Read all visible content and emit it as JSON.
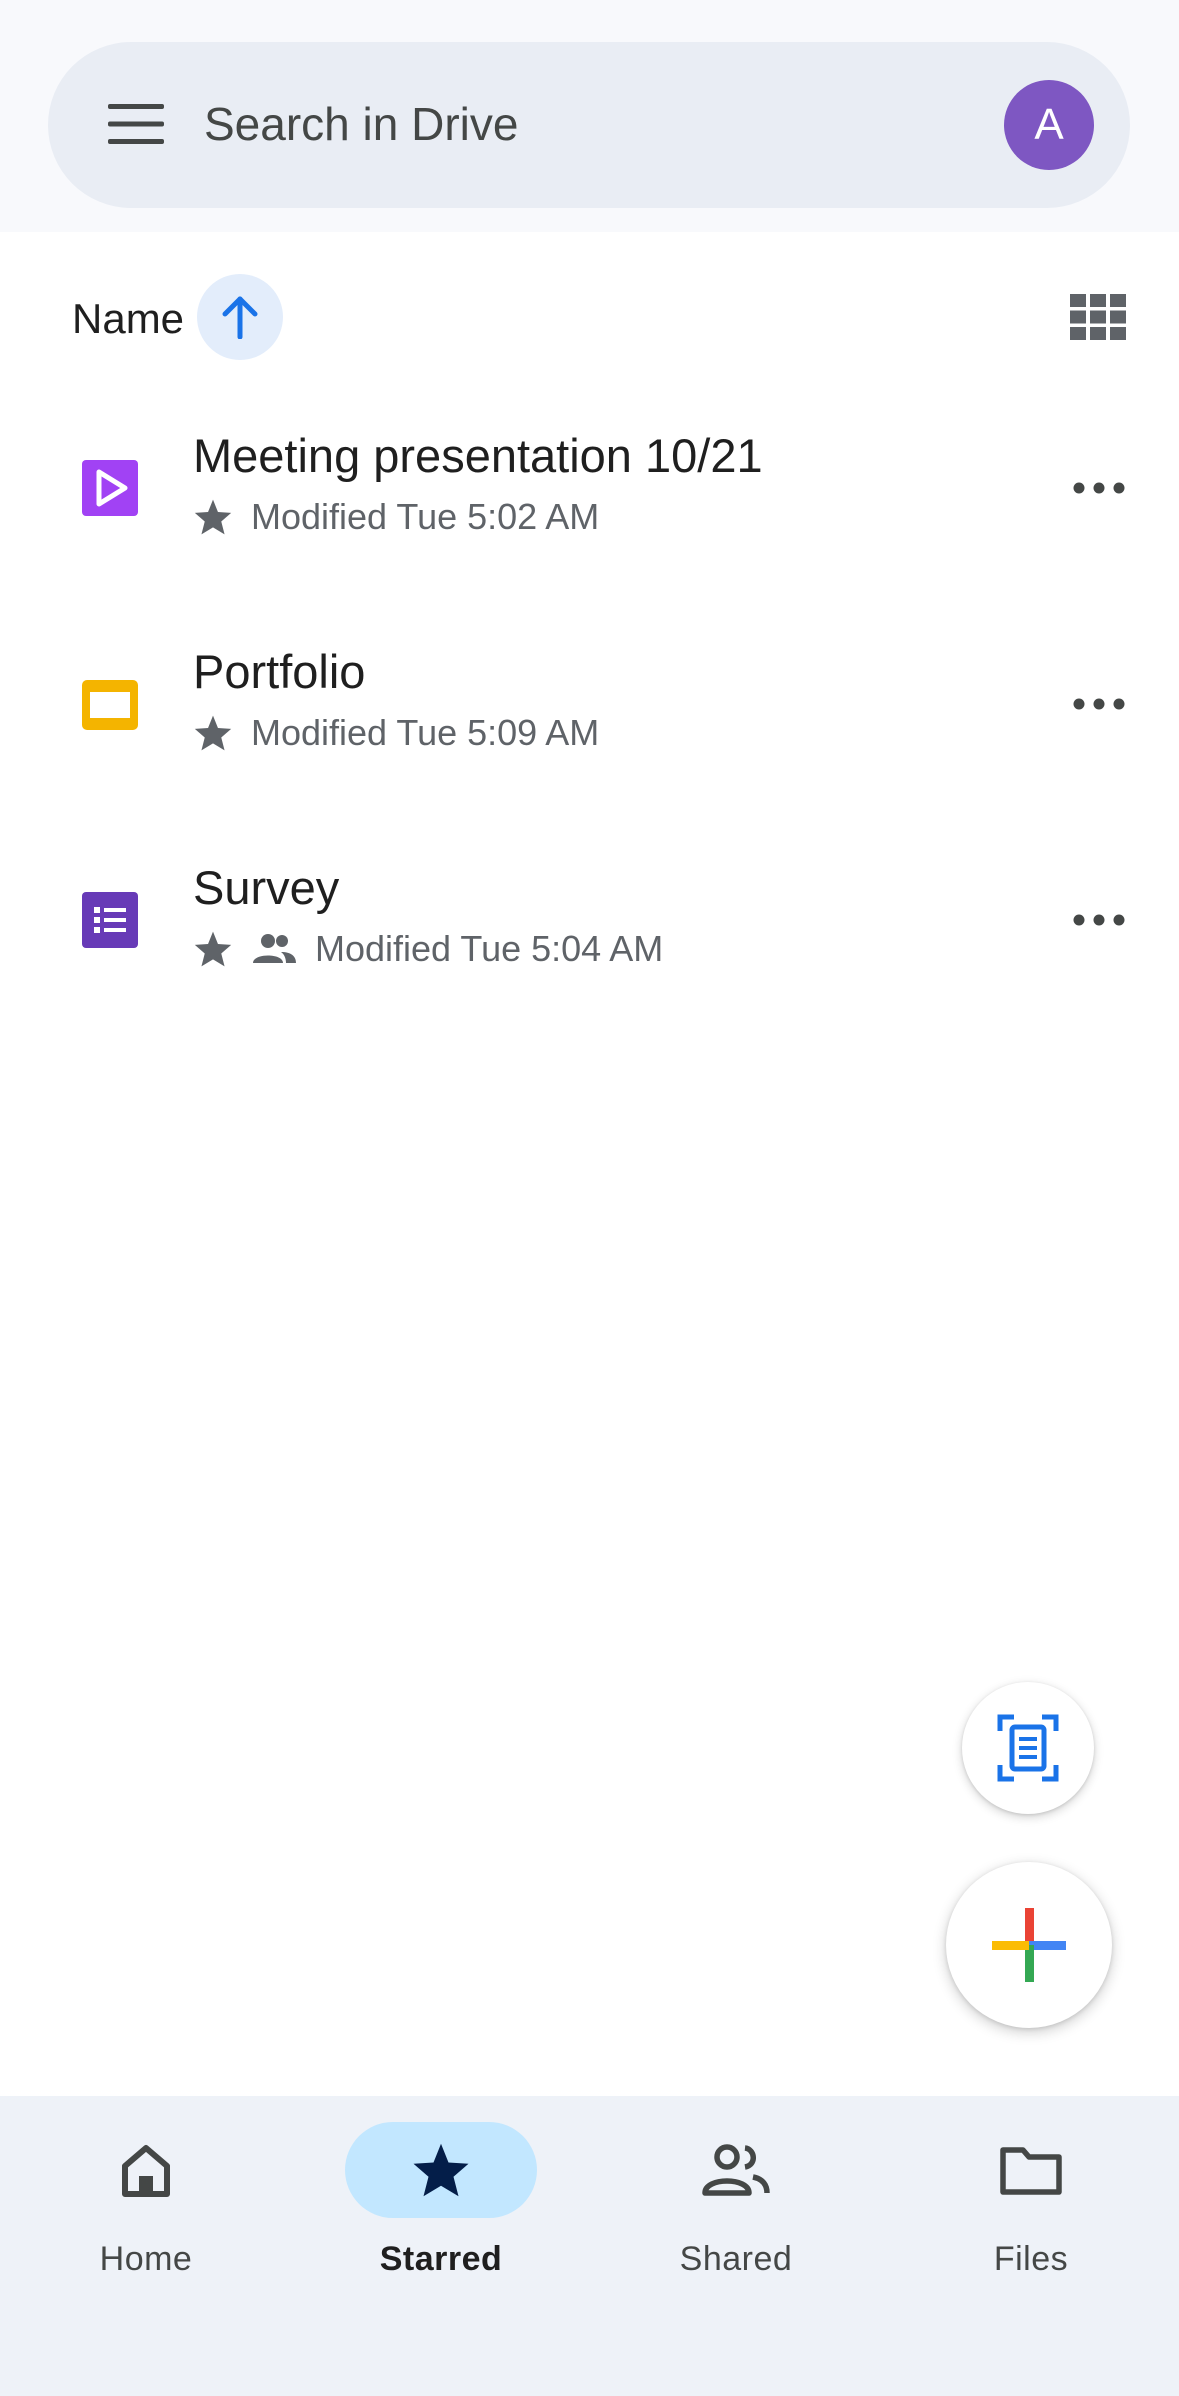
{
  "search": {
    "placeholder": "Search in Drive",
    "avatar_letter": "A",
    "avatar_color": "#7e57c2"
  },
  "sort": {
    "label": "Name",
    "direction": "ascending"
  },
  "files": [
    {
      "title": "Meeting presentation 10/21",
      "modified": "Modified Tue 5:02 AM",
      "starred": true,
      "shared": false,
      "type": "vids",
      "color": "#9334e6"
    },
    {
      "title": "Portfolio",
      "modified": "Modified Tue 5:09 AM",
      "starred": true,
      "shared": false,
      "type": "slides",
      "color": "#f4b400"
    },
    {
      "title": "Survey",
      "modified": "Modified Tue 5:04 AM",
      "starred": true,
      "shared": true,
      "type": "forms",
      "color": "#673ab7"
    }
  ],
  "nav": [
    {
      "label": "Home",
      "icon": "home-icon",
      "active": false
    },
    {
      "label": "Starred",
      "icon": "star-icon",
      "active": true
    },
    {
      "label": "Shared",
      "icon": "people-icon",
      "active": false
    },
    {
      "label": "Files",
      "icon": "folder-icon",
      "active": false
    }
  ],
  "colors": {
    "accent": "#1a73e8",
    "active_pill": "#c2e7ff"
  }
}
